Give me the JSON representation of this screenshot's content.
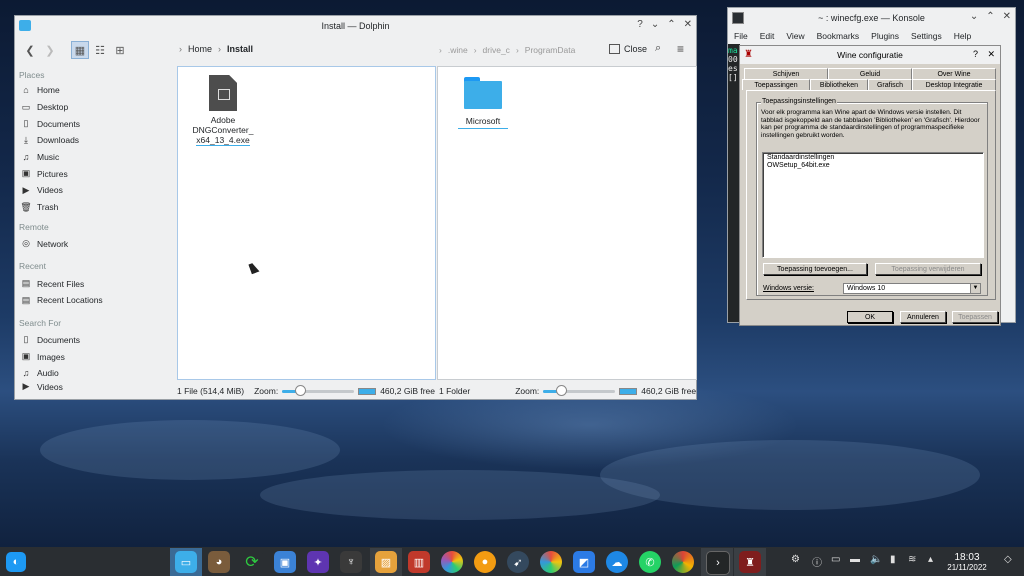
{
  "dolphin": {
    "title": "Install — Dolphin",
    "controls": [
      "?",
      "⌄",
      "⌃",
      "✕"
    ],
    "breadcrumb_left": [
      "Home",
      "Install"
    ],
    "breadcrumb_right": [
      ".wine",
      "drive_c",
      "ProgramData"
    ],
    "close_label": "Close",
    "sidebar": {
      "places_header": "Places",
      "places": [
        "Home",
        "Desktop",
        "Documents",
        "Downloads",
        "Music",
        "Pictures",
        "Videos",
        "Trash"
      ],
      "remote_header": "Remote",
      "remote": [
        "Network"
      ],
      "recent_header": "Recent",
      "recent": [
        "Recent Files",
        "Recent Locations"
      ],
      "search_header": "Search For",
      "search": [
        "Documents",
        "Images",
        "Audio",
        "Videos"
      ]
    },
    "left_pane": {
      "file_name_lines": [
        "Adobe",
        "DNGConverter_",
        "x64_13_4.exe"
      ],
      "status": "1 File (514,4 MiB)",
      "zoom_label": "Zoom:",
      "free": "460,2 GiB free"
    },
    "right_pane": {
      "folder_name": "Microsoft",
      "status": "1 Folder",
      "zoom_label": "Zoom:",
      "free": "460,2 GiB free"
    },
    "zoom_level": 0.25
  },
  "konsole": {
    "title": "~ : winecfg.exe — Konsole",
    "menu": [
      "File",
      "Edit",
      "View",
      "Bookmarks",
      "Plugins",
      "Settings",
      "Help"
    ],
    "term_lines": [
      "ma",
      "00",
      "es",
      "[]"
    ]
  },
  "wine": {
    "title": "Wine configuratie",
    "tabs_row1": [
      "Schijven",
      "Geluid",
      "Over Wine"
    ],
    "tabs_row2": [
      "Toepassingen",
      "Bibliotheken",
      "Grafisch",
      "Desktop Integratie"
    ],
    "group_title": "Toepassingsinstellingen",
    "description": "Voor elk programma kan Wine apart de Windows versie instellen. Dit tabblad isgekoppeld aan de tabbladen 'Bibliotheken' en 'Grafisch'. Hierdoor kan per programma de standaardinstellingen of programmaspecifieke instellingen gebruikt worden.",
    "apps": [
      "Standaardinstellingen",
      "OWSetup_64bit.exe"
    ],
    "add_button": "Toepassing toevoegen...",
    "remove_button": "Toepassing verwijderen",
    "version_label": "Windows versie:",
    "version_value": "Windows 10",
    "ok": "OK",
    "cancel": "Annuleren",
    "apply": "Toepassen"
  },
  "taskbar": {
    "time": "18:03",
    "date": "21/11/2022"
  },
  "colors": {
    "accent": "#3daee9",
    "folder": "#3daee9",
    "taskbar": "#2a2e32"
  }
}
